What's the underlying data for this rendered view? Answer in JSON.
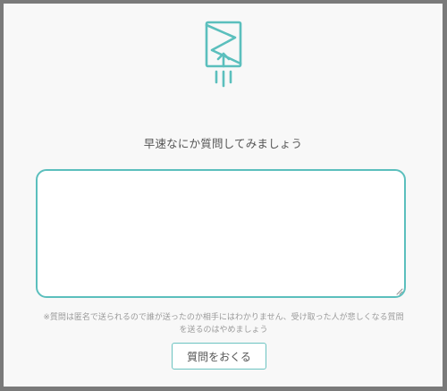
{
  "colors": {
    "accent": "#5bbfbd",
    "background": "#f8f8f8",
    "frame_border": "#7a7a7a",
    "text": "#555555",
    "muted_text": "#9a9a9a"
  },
  "header": {
    "logo_icon": "envelope-upload-icon"
  },
  "form": {
    "prompt": "早速なにか質問してみましょう",
    "textarea_value": "",
    "textarea_placeholder": "",
    "notice": "※質問は匿名で送られるので誰が送ったのか相手にはわかりません、受け取った人が悲しくなる質問を送るのはやめましょう",
    "submit_label": "質問をおくる"
  }
}
